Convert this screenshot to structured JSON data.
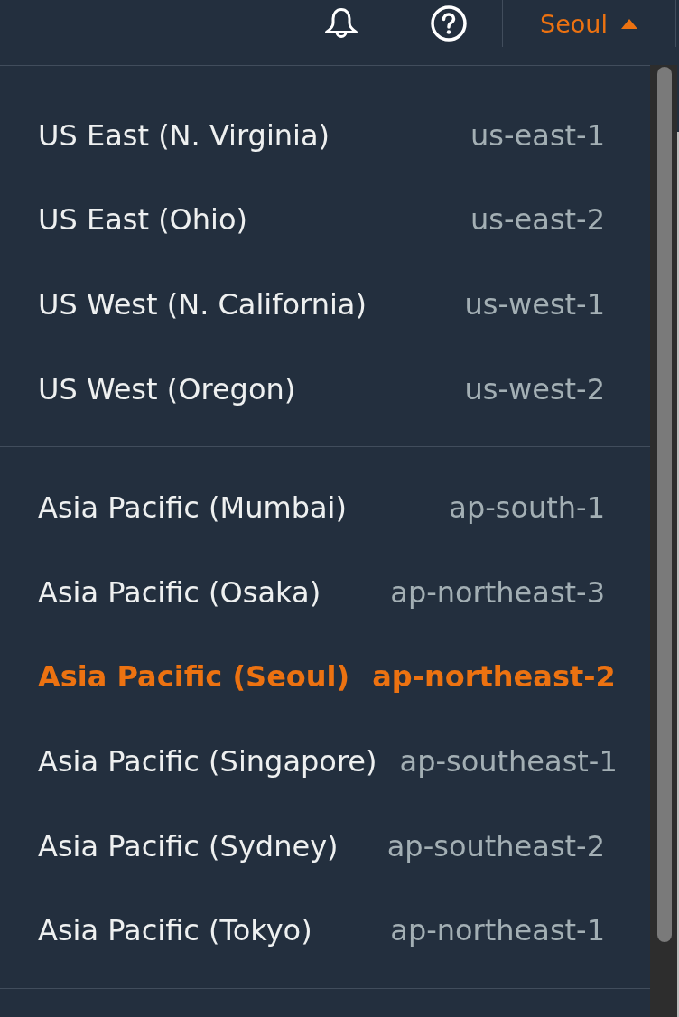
{
  "top_bar": {
    "region_menu": {
      "label": "Seoul",
      "expanded": true
    }
  },
  "region_groups": [
    {
      "regions": [
        {
          "name": "US East (N. Virginia)",
          "code": "us-east-1",
          "selected": false
        },
        {
          "name": "US East (Ohio)",
          "code": "us-east-2",
          "selected": false
        },
        {
          "name": "US West (N. California)",
          "code": "us-west-1",
          "selected": false
        },
        {
          "name": "US West (Oregon)",
          "code": "us-west-2",
          "selected": false
        }
      ]
    },
    {
      "regions": [
        {
          "name": "Asia Pacific (Mumbai)",
          "code": "ap-south-1",
          "selected": false
        },
        {
          "name": "Asia Pacific (Osaka)",
          "code": "ap-northeast-3",
          "selected": false
        },
        {
          "name": "Asia Pacific (Seoul)",
          "code": "ap-northeast-2",
          "selected": true
        },
        {
          "name": "Asia Pacific (Singapore)",
          "code": "ap-southeast-1",
          "selected": false
        },
        {
          "name": "Asia Pacific (Sydney)",
          "code": "ap-southeast-2",
          "selected": false
        },
        {
          "name": "Asia Pacific (Tokyo)",
          "code": "ap-northeast-1",
          "selected": false
        }
      ]
    }
  ]
}
